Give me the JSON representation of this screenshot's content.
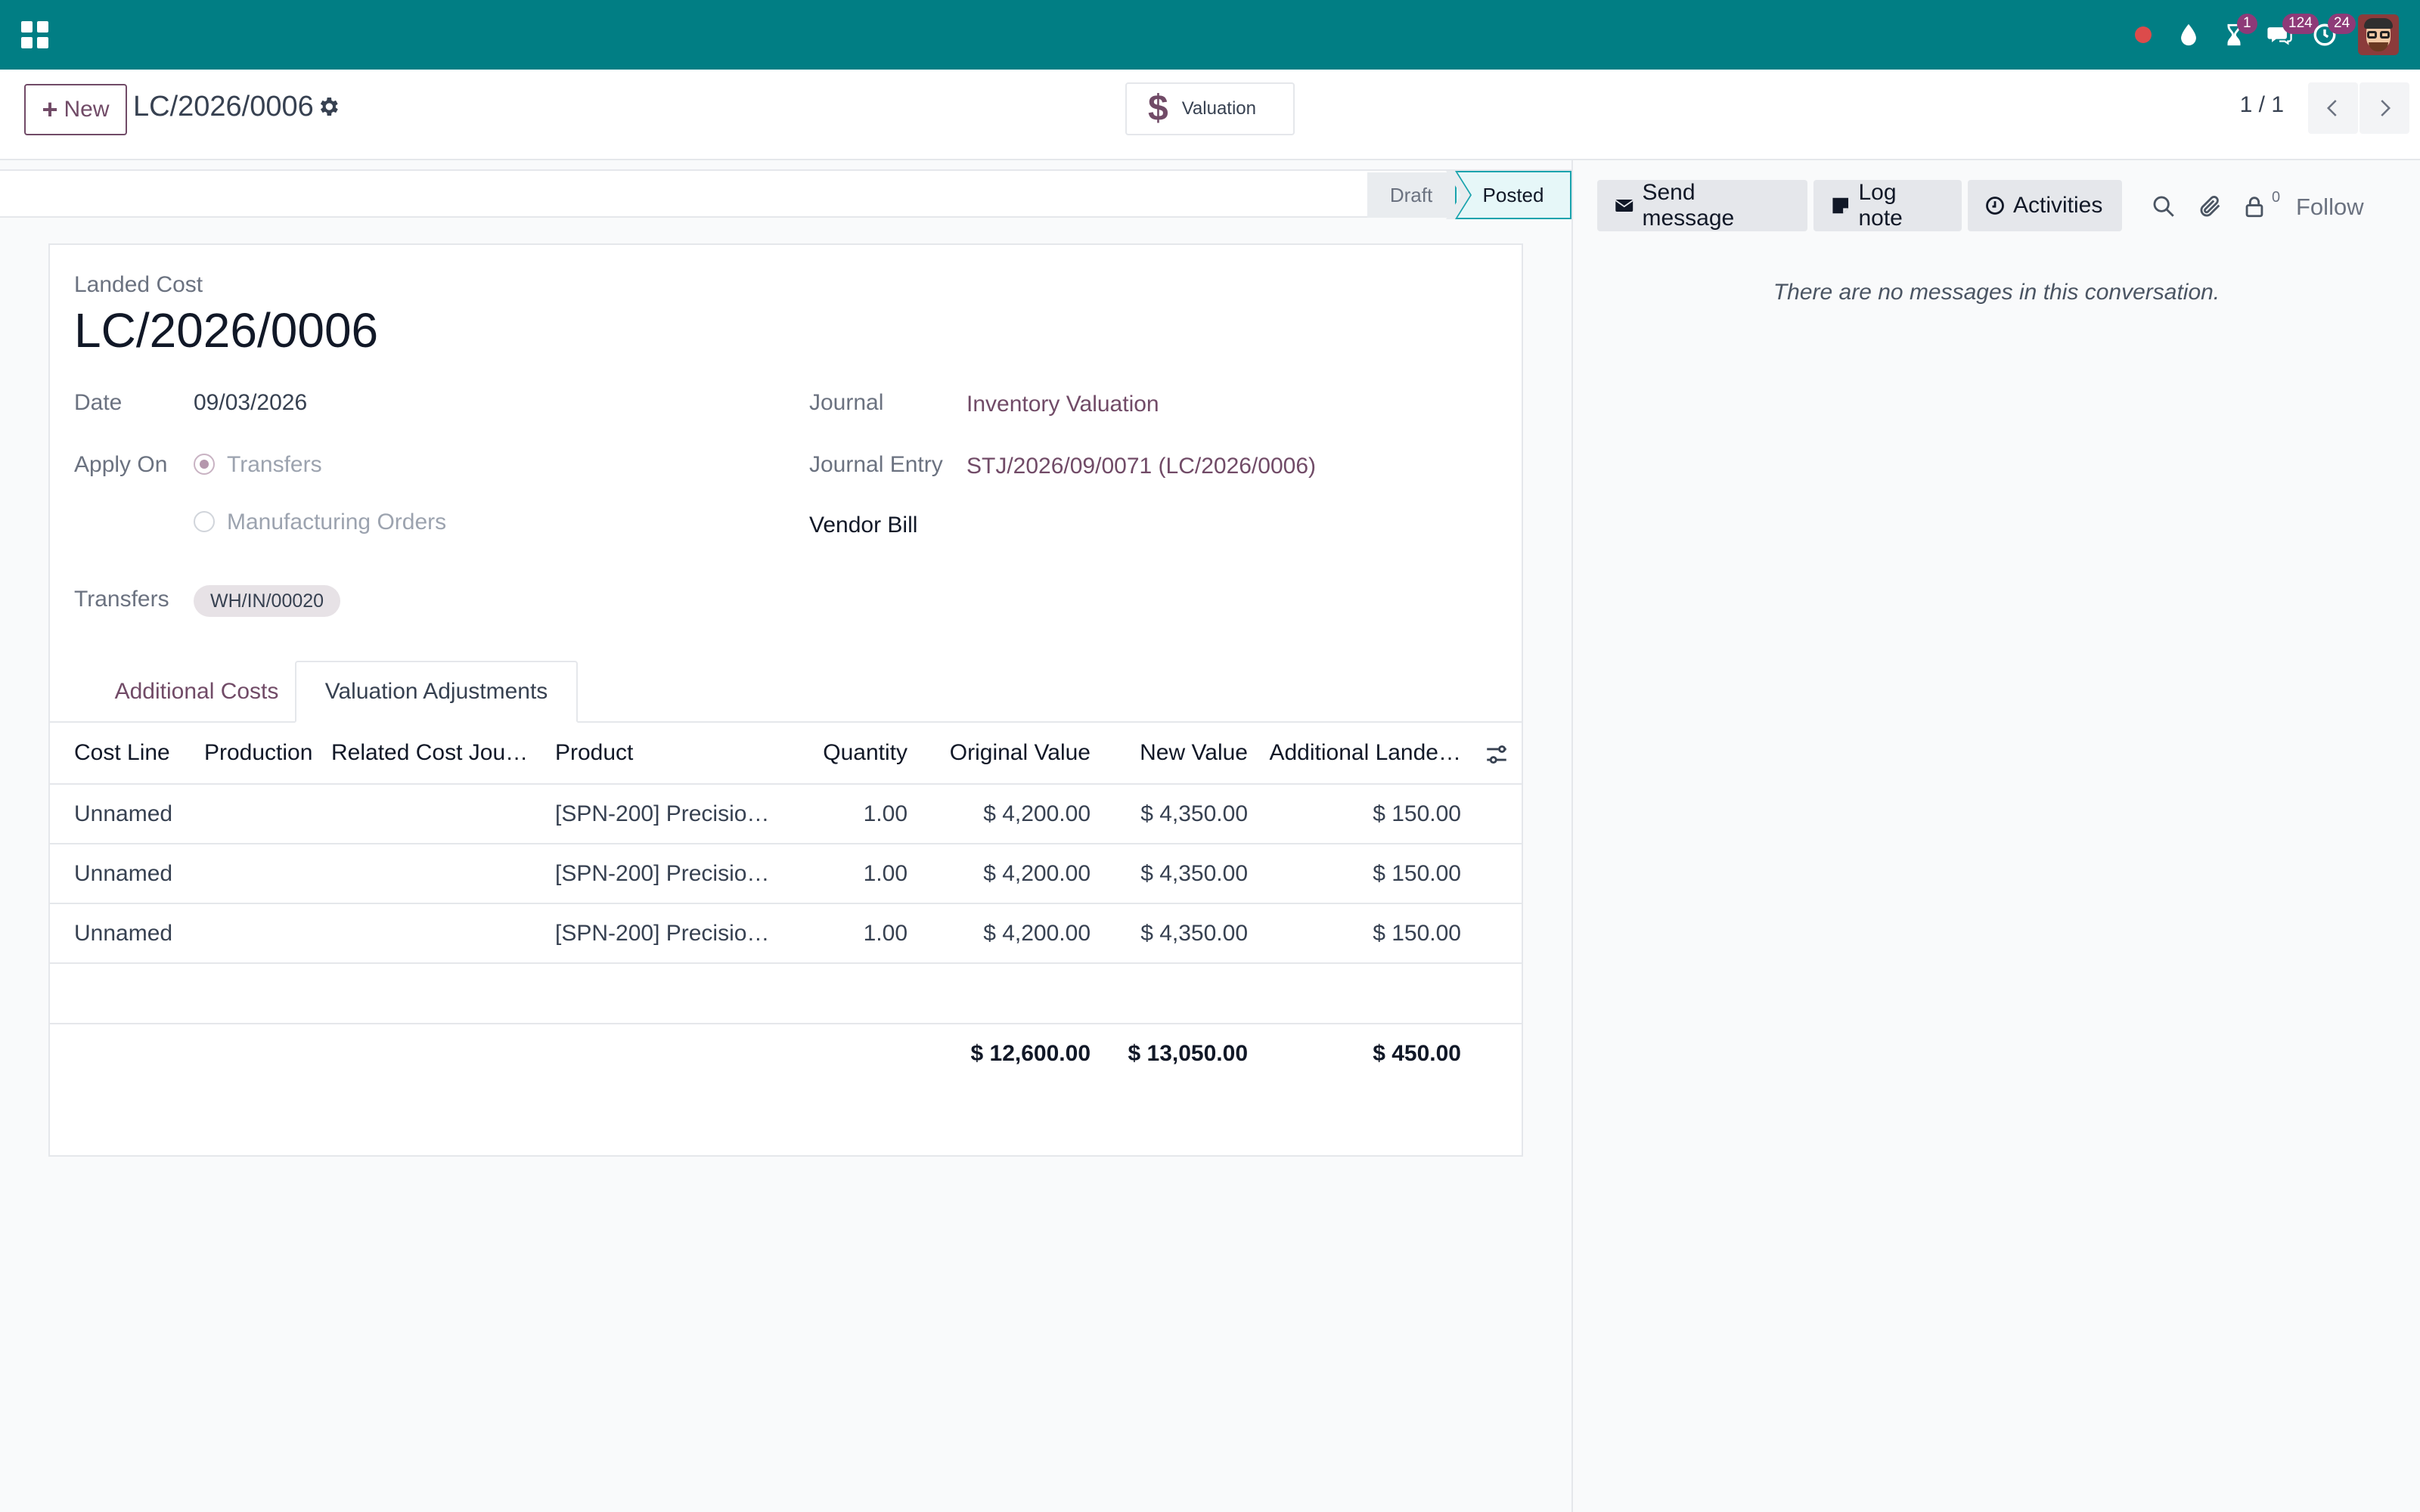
{
  "navbar": {
    "messages_count": "124",
    "activities_count": "24",
    "timer_count": "1",
    "colors": {
      "bar": "#017e84",
      "badge": "#8e3a78",
      "record": "#dc4b4b"
    }
  },
  "control": {
    "new_label": "New",
    "record_name": "LC/2026/0006",
    "valuation_label": "Valuation",
    "pager": "1 / 1"
  },
  "status": {
    "draft": "Draft",
    "posted": "Posted",
    "current": "Posted"
  },
  "form": {
    "subtitle": "Landed Cost",
    "title": "LC/2026/0006",
    "date_label": "Date",
    "date_value": "09/03/2026",
    "apply_on_label": "Apply On",
    "apply_on_options": [
      "Transfers",
      "Manufacturing Orders"
    ],
    "apply_on_selected": "Transfers",
    "journal_label": "Journal",
    "journal_value": "Inventory Valuation",
    "journal_entry_label": "Journal Entry",
    "journal_entry_value": "STJ/2026/09/0071 (LC/2026/0006)",
    "vendor_bill_label": "Vendor Bill",
    "transfers_label": "Transfers",
    "transfers_tag": "WH/IN/00020",
    "tabs": [
      "Additional Costs",
      "Valuation Adjustments"
    ],
    "active_tab": "Valuation Adjustments"
  },
  "table": {
    "headers": [
      "Cost Line",
      "Production",
      "Related Cost Jou…",
      "Product",
      "Quantity",
      "Original Value",
      "New Value",
      "Additional Lande…"
    ],
    "rows": [
      [
        "Unnamed",
        "",
        "",
        "[SPN-200] Precisio…",
        "1.00",
        "$ 4,200.00",
        "$ 4,350.00",
        "$ 150.00"
      ],
      [
        "Unnamed",
        "",
        "",
        "[SPN-200] Precisio…",
        "1.00",
        "$ 4,200.00",
        "$ 4,350.00",
        "$ 150.00"
      ],
      [
        "Unnamed",
        "",
        "",
        "[SPN-200] Precisio…",
        "1.00",
        "$ 4,200.00",
        "$ 4,350.00",
        "$ 150.00"
      ]
    ],
    "totals": {
      "original": "$ 12,600.00",
      "new": "$ 13,050.00",
      "additional": "$ 450.00"
    }
  },
  "chatter": {
    "send_message": "Send message",
    "log_note": "Log note",
    "activities": "Activities",
    "followers_count": "0",
    "follow": "Follow",
    "empty_text": "There are no messages in this conversation."
  }
}
